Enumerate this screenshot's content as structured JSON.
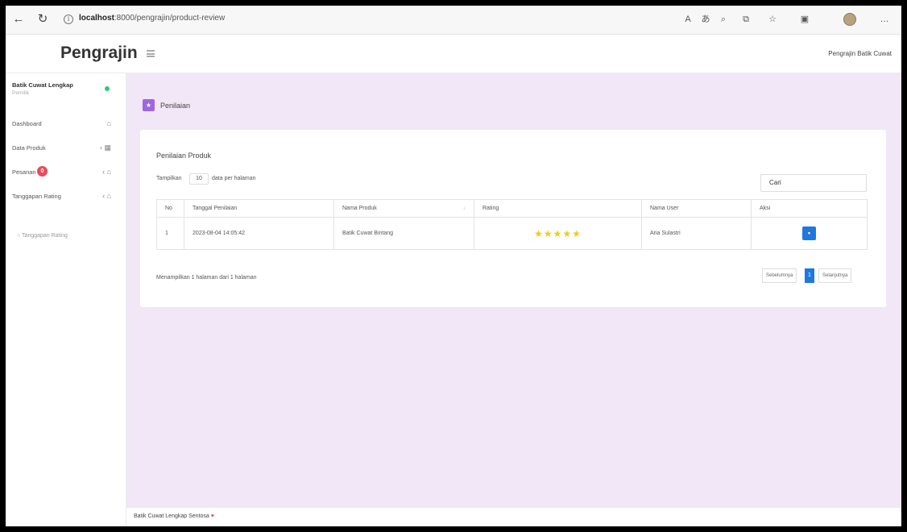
{
  "browser": {
    "url_host": "localhost",
    "url_path": ":8000/pengrajin/product-review"
  },
  "header": {
    "brand": "Pengrajin",
    "user_menu": "Pengrajin Batik Cuwat"
  },
  "sidebar": {
    "user_name": "Batik Cuwat Lengkap",
    "user_role": "Pemilik",
    "items": [
      {
        "label": "Dashboard"
      },
      {
        "label": "Data Produk"
      },
      {
        "label": "Pesanan",
        "badge": "0"
      },
      {
        "label": "Tanggapan Rating"
      }
    ],
    "sub_item": "Tanggapan Rating"
  },
  "page": {
    "title": "Penilaian"
  },
  "card": {
    "title": "Penilaian Produk",
    "length_label": "Tampilkan",
    "length_value": "10",
    "length_suffix": "data per halaman",
    "search_placeholder": "Cari",
    "columns": [
      "No",
      "Tanggal Penilaian",
      "Nama Produk",
      "Rating",
      "Nama User",
      "Aksi"
    ],
    "rows": [
      {
        "no": "1",
        "date": "2023-08-04 14:05:42",
        "product": "Batik Cuwat Bintang",
        "stars": "★★★★★",
        "user": "Aria Sulastri"
      }
    ],
    "info": "Menampilkan 1 halaman dari 1 halaman",
    "pagination": {
      "prev": "Sebelumnya",
      "current": "1",
      "next": "Selanjutnya"
    }
  },
  "footer": {
    "text": "Batik Cuwat Lengkap Sentosa"
  },
  "colors": {
    "accent": "#1f78e0",
    "page_bg": "#f1e7f6",
    "title_icon": "#9e67e0",
    "star": "#f6c915",
    "badge": "#e74c5c"
  }
}
